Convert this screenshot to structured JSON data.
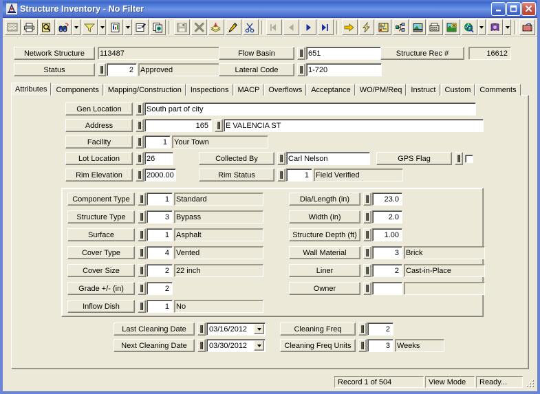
{
  "window": {
    "title": "Structure Inventory - No Filter",
    "icon": "app-structure-icon",
    "minimize_label": "Minimize",
    "maximize_label": "Maximize",
    "close_label": "Close"
  },
  "toolbar": {
    "groups": [
      {
        "buttons": [
          {
            "name": "new-record-icon",
            "label": "New",
            "glyph": "grid"
          },
          {
            "name": "print-icon",
            "label": "Print",
            "glyph": "printer"
          },
          {
            "name": "print-preview-icon",
            "label": "Print Preview",
            "glyph": "preview"
          },
          {
            "name": "find-icon",
            "label": "Find",
            "glyph": "binoculars",
            "dropdown": true
          },
          {
            "name": "filter-icon",
            "label": "Filter",
            "glyph": "funnel",
            "dropdown": true
          },
          {
            "name": "report-icon",
            "label": "Report",
            "glyph": "report",
            "dropdown": true
          },
          {
            "name": "properties-icon",
            "label": "Properties",
            "glyph": "props"
          },
          {
            "name": "copy-record-icon",
            "label": "Copy Record",
            "glyph": "copydoc"
          }
        ]
      },
      {
        "buttons": [
          {
            "name": "save-icon",
            "label": "Save",
            "glyph": "floppy"
          },
          {
            "name": "delete-icon",
            "label": "Delete",
            "glyph": "bigx"
          },
          {
            "name": "post-icon",
            "label": "Post",
            "glyph": "stack"
          },
          {
            "name": "edit-icon",
            "label": "Edit",
            "glyph": "pencil"
          },
          {
            "name": "cut-icon",
            "label": "Cut",
            "glyph": "scissors"
          }
        ]
      },
      {
        "buttons": [
          {
            "name": "first-record-icon",
            "label": "First Record",
            "glyph": "first",
            "disabled": true
          },
          {
            "name": "previous-record-icon",
            "label": "Previous Record",
            "glyph": "prev",
            "disabled": true
          },
          {
            "name": "next-record-icon",
            "label": "Next Record",
            "glyph": "next"
          },
          {
            "name": "last-record-icon",
            "label": "Last Record",
            "glyph": "last"
          }
        ]
      },
      {
        "buttons": [
          {
            "name": "goto-icon",
            "label": "Go To",
            "glyph": "yellowarrow"
          },
          {
            "name": "quick-action-icon",
            "label": "Quick Action",
            "glyph": "bolt"
          },
          {
            "name": "map-icon",
            "label": "Map",
            "glyph": "map"
          },
          {
            "name": "tree-icon",
            "label": "Tree View",
            "glyph": "tree"
          },
          {
            "name": "image-icon",
            "label": "Images",
            "glyph": "image"
          },
          {
            "name": "fax-icon",
            "label": "Fax",
            "glyph": "fax"
          },
          {
            "name": "gis-icon",
            "label": "GIS",
            "glyph": "gis"
          },
          {
            "name": "web-icon",
            "label": "Web",
            "glyph": "globe",
            "dropdown": true
          },
          {
            "name": "help-icon",
            "label": "Help",
            "glyph": "book",
            "dropdown": true
          }
        ]
      },
      {
        "buttons": [
          {
            "name": "exit-icon",
            "label": "Exit",
            "glyph": "exit"
          }
        ]
      }
    ]
  },
  "header": {
    "network_structure": {
      "label": "Network Structure",
      "value": "113487"
    },
    "status": {
      "label": "Status",
      "code": "2",
      "value": "Approved"
    },
    "flow_basin": {
      "label": "Flow Basin",
      "value": "651"
    },
    "lateral_code": {
      "label": "Lateral Code",
      "value": "1-720"
    },
    "structure_rec": {
      "label": "Structure Rec #",
      "value": "16612"
    }
  },
  "tabs": [
    {
      "label": "Attributes",
      "active": true
    },
    {
      "label": "Components",
      "active": false
    },
    {
      "label": "Mapping/Construction",
      "active": false
    },
    {
      "label": "Inspections",
      "active": false
    },
    {
      "label": "MACP",
      "active": false
    },
    {
      "label": "Overflows",
      "active": false
    },
    {
      "label": "Acceptance",
      "active": false
    },
    {
      "label": "WO/PM/Req",
      "active": false
    },
    {
      "label": "Instruct",
      "active": false
    },
    {
      "label": "Custom",
      "active": false
    },
    {
      "label": "Comments",
      "active": false
    }
  ],
  "attributes": {
    "gen_location": {
      "label": "Gen Location",
      "value": "South part of city"
    },
    "address": {
      "label": "Address",
      "number": "165",
      "street": "E VALENCIA ST"
    },
    "facility": {
      "label": "Facility",
      "code": "1",
      "value": "Your Town"
    },
    "lot_location": {
      "label": "Lot Location",
      "value": "26"
    },
    "collected_by": {
      "label": "Collected By",
      "value": "Carl Nelson"
    },
    "gps_flag": {
      "label": "GPS Flag",
      "checked": false
    },
    "rim_elevation": {
      "label": "Rim Elevation",
      "value": "2000.00"
    },
    "rim_status": {
      "label": "Rim Status",
      "code": "1",
      "value": "Field Verified"
    }
  },
  "structure_group": {
    "left": [
      {
        "label": "Component Type",
        "code": "1",
        "value": "Standard",
        "has_desc": true
      },
      {
        "label": "Structure Type",
        "code": "3",
        "value": "Bypass",
        "has_desc": true
      },
      {
        "label": "Surface",
        "code": "1",
        "value": "Asphalt",
        "has_desc": true
      },
      {
        "label": "Cover Type",
        "code": "4",
        "value": "Vented",
        "has_desc": true
      },
      {
        "label": "Cover Size",
        "code": "2",
        "value": "22 inch",
        "has_desc": true
      },
      {
        "label": "Grade +/- (in)",
        "code": "2",
        "value": "",
        "has_desc": false
      },
      {
        "label": "Inflow Dish",
        "code": "1",
        "value": "No",
        "has_desc": true
      }
    ],
    "right": [
      {
        "label": "Dia/Length (in)",
        "code": "23.0",
        "value": "",
        "has_desc": false
      },
      {
        "label": "Width (in)",
        "code": "2.0",
        "value": "",
        "has_desc": false
      },
      {
        "label": "Structure Depth (ft)",
        "code": "1.00",
        "value": "",
        "has_desc": false
      },
      {
        "label": "Wall Material",
        "code": "3",
        "value": "Brick",
        "has_desc": true
      },
      {
        "label": "Liner",
        "code": "2",
        "value": "Cast-in-Place",
        "has_desc": true
      },
      {
        "label": "Owner",
        "code": "",
        "value": "",
        "has_desc": true
      }
    ]
  },
  "cleaning": {
    "last_cleaning_date": {
      "label": "Last Cleaning Date",
      "value": "03/16/2012"
    },
    "next_cleaning_date": {
      "label": "Next Cleaning Date",
      "value": "03/30/2012"
    },
    "cleaning_freq": {
      "label": "Cleaning Freq",
      "value": "2"
    },
    "cleaning_freq_units": {
      "label": "Cleaning Freq Units",
      "code": "3",
      "value": "Weeks"
    }
  },
  "statusbar": {
    "record": "Record 1 of 504",
    "mode": "View Mode",
    "state": "Ready..."
  },
  "colors": {
    "face": "#ece9d8",
    "title_start": "#5a7fd4",
    "title_end": "#3e5fc2",
    "frame": "#6a84d6",
    "close": "#c75a4f",
    "field_bg": "#ffffff",
    "text": "#000000"
  }
}
